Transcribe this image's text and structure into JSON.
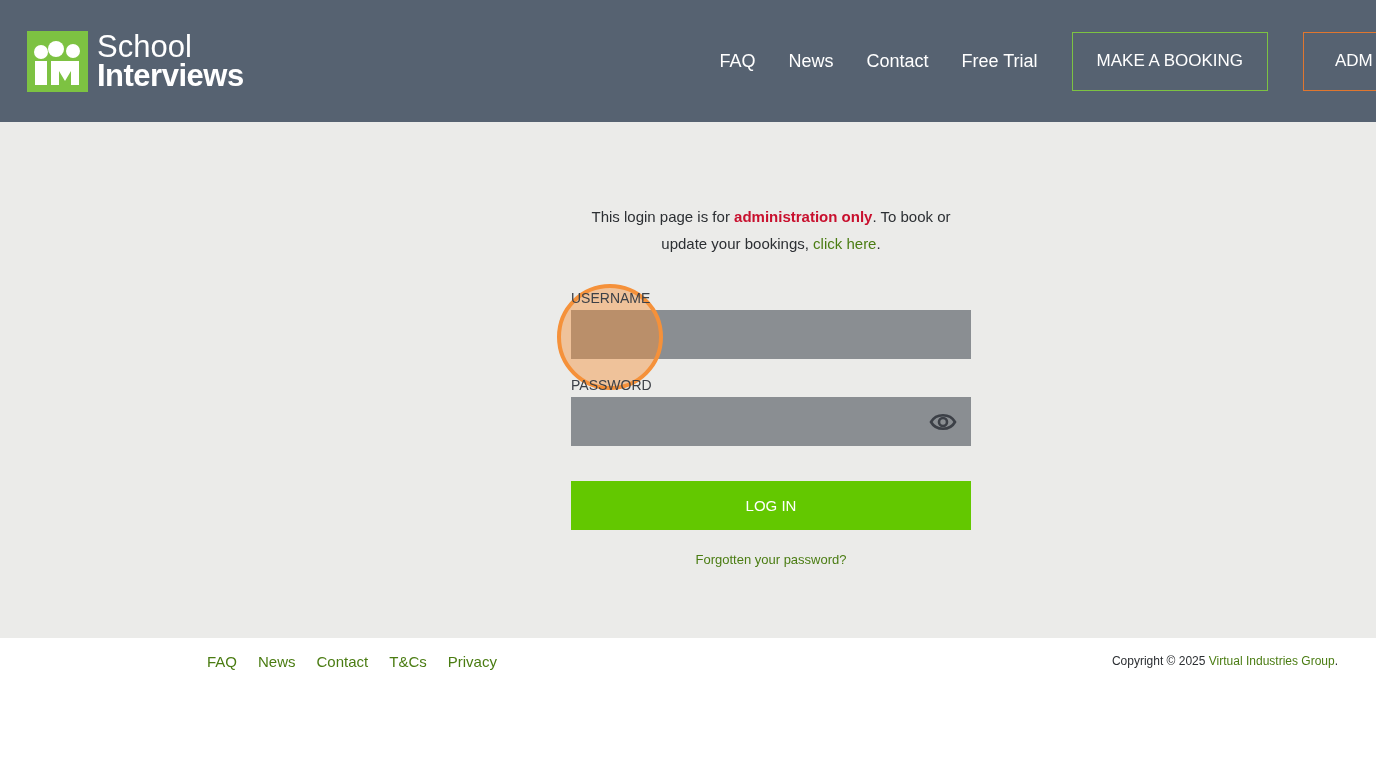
{
  "header": {
    "logo": {
      "line1": "School",
      "line2": "Interviews"
    },
    "nav": [
      {
        "label": "FAQ"
      },
      {
        "label": "News"
      },
      {
        "label": "Contact"
      },
      {
        "label": "Free Trial"
      }
    ],
    "buttons": [
      {
        "label": "MAKE A BOOKING",
        "kind": "booking"
      },
      {
        "label": "ADM",
        "kind": "admin"
      }
    ]
  },
  "notice": {
    "text": "This login page is for **administration only**. To book or",
    "text2": "update your bookings, ",
    "link": "click here",
    "after": "."
  },
  "form": {
    "fields": [
      {
        "label": "USERNAME",
        "kind": "text"
      },
      {
        "label": "PASSWORD",
        "kind": "password"
      }
    ],
    "submit": "LOG IN",
    "forgot": "Forgotten your password?"
  },
  "footer": {
    "links": [
      {
        "label": "FAQ"
      },
      {
        "label": "News"
      },
      {
        "label": "Contact"
      },
      {
        "label": "T&Cs"
      },
      {
        "label": "Privacy"
      }
    ],
    "copyright": "Copyright © 2025 ",
    "company": "Virtual Industries Group",
    "after": "."
  }
}
